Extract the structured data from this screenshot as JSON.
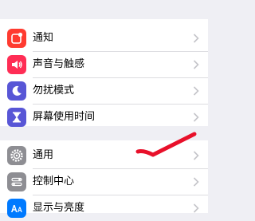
{
  "settings": {
    "group1": [
      {
        "label": "通知",
        "icon": "notifications-icon",
        "color": "#ff3b30"
      },
      {
        "label": "声音与触感",
        "icon": "speaker-icon",
        "color": "#ff2d55"
      },
      {
        "label": "勿扰模式",
        "icon": "moon-icon",
        "color": "#5856d6"
      },
      {
        "label": "屏幕使用时间",
        "icon": "hourglass-icon",
        "color": "#5856d6"
      }
    ],
    "group2": [
      {
        "label": "通用",
        "icon": "gear-icon",
        "color": "#8e8e93"
      },
      {
        "label": "控制中心",
        "icon": "control-center-icon",
        "color": "#8e8e93"
      },
      {
        "label": "显示与亮度",
        "icon": "display-brightness-icon",
        "color": "#007aff"
      }
    ]
  },
  "annotation": {
    "icon": "red-checkmark-icon",
    "color": "#e8102a"
  }
}
